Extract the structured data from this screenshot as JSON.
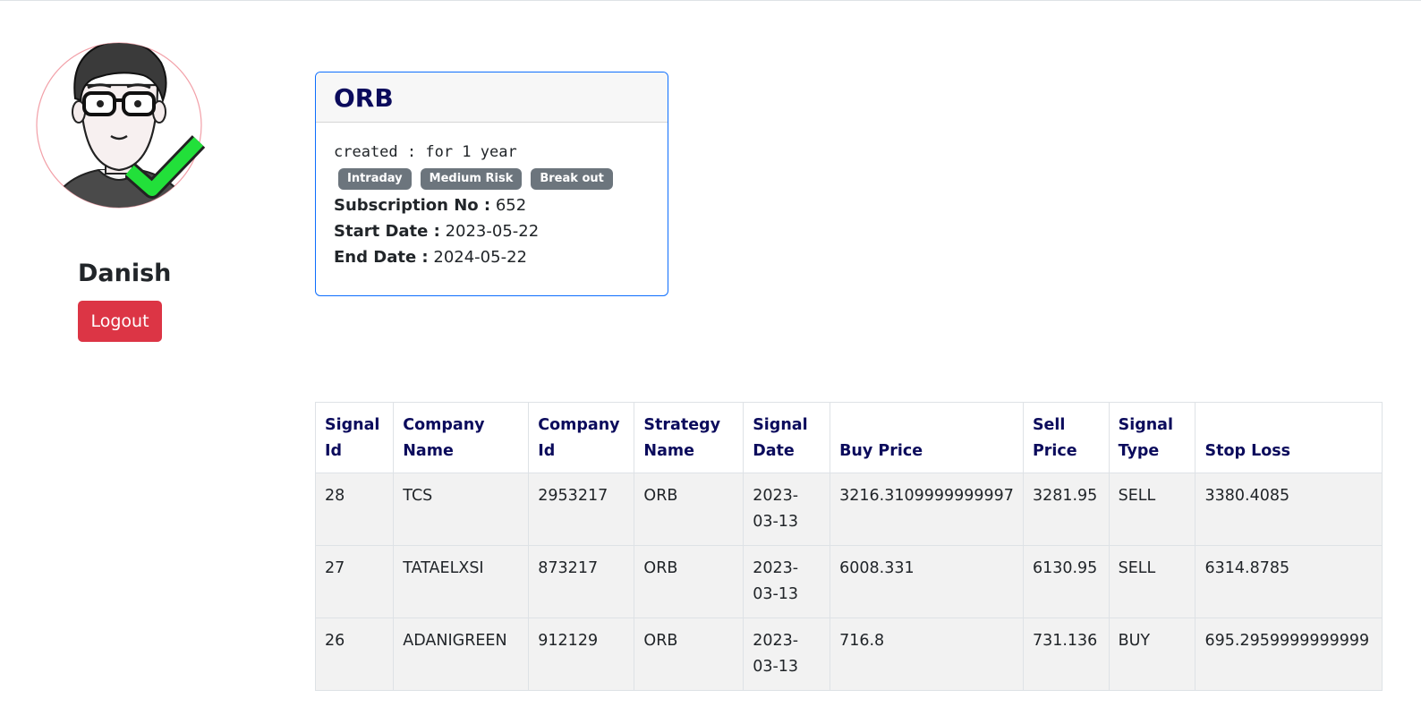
{
  "user": {
    "name": "Danish",
    "logout_label": "Logout"
  },
  "strategy_card": {
    "title": "ORB",
    "created_text": "created : for 1 year",
    "tags": [
      "Intraday",
      "Medium Risk",
      "Break out"
    ],
    "subscription_label": "Subscription No :",
    "subscription_value": "652",
    "start_label": "Start Date :",
    "start_value": "2023-05-22",
    "end_label": "End Date :",
    "end_value": "2024-05-22"
  },
  "signals_table": {
    "headers": [
      "Signal Id",
      "Company Name",
      "Company Id",
      "Strategy Name",
      "Signal Date",
      "Buy Price",
      "Sell Price",
      "Signal Type",
      "Stop Loss"
    ],
    "rows": [
      [
        "28",
        "TCS",
        "2953217",
        "ORB",
        "2023-03-13",
        "3216.3109999999997",
        "3281.95",
        "SELL",
        "3380.4085"
      ],
      [
        "27",
        "TATAELXSI",
        "873217",
        "ORB",
        "2023-03-13",
        "6008.331",
        "6130.95",
        "SELL",
        "6314.8785"
      ],
      [
        "26",
        "ADANIGREEN",
        "912129",
        "ORB",
        "2023-03-13",
        "716.8",
        "731.136",
        "BUY",
        "695.2959999999999"
      ]
    ]
  },
  "colors": {
    "accent_blue": "#0d6efd",
    "danger_red": "#dc3545",
    "badge_gray": "#6c757d",
    "heading_navy": "#0b0b5c",
    "check_green": "#22e03a"
  },
  "icons": {
    "avatar": "user-avatar-with-glasses",
    "verified": "green-check-icon"
  }
}
